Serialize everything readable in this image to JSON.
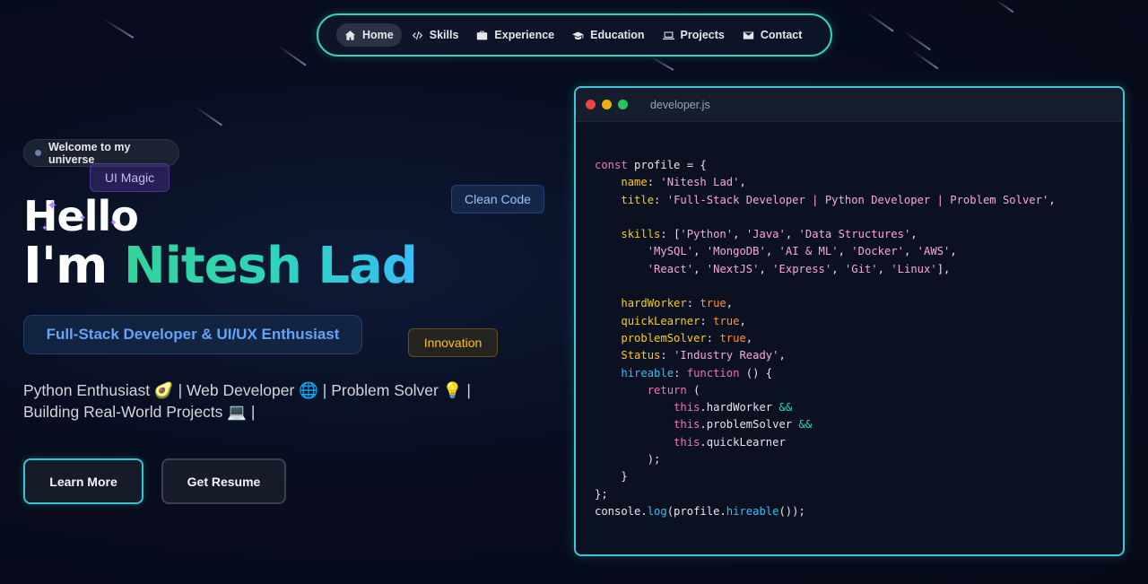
{
  "nav": {
    "items": [
      {
        "label": "Home",
        "icon": "home-icon",
        "active": true
      },
      {
        "label": "Skills",
        "icon": "code-icon",
        "active": false
      },
      {
        "label": "Experience",
        "icon": "briefcase-icon",
        "active": false
      },
      {
        "label": "Education",
        "icon": "graduation-cap-icon",
        "active": false
      },
      {
        "label": "Projects",
        "icon": "laptop-icon",
        "active": false
      },
      {
        "label": "Contact",
        "icon": "envelope-icon",
        "active": false
      }
    ]
  },
  "hero": {
    "welcome": "Welcome to my universe",
    "hello": "Hello",
    "iam_prefix": "I'm ",
    "name": "Nitesh Lad",
    "role": "Full-Stack Developer & UI/UX Enthusiast",
    "tagline": "Python Enthusiast 🥑 | Web Developer 🌐 | Problem Solver 💡 | Building Real-World Projects 💻 |",
    "learn_more": "Learn More",
    "get_resume": "Get Resume"
  },
  "floating_tags": {
    "ui_magic": "UI Magic",
    "clean_code": "Clean Code",
    "innovation": "Innovation"
  },
  "code_window": {
    "filename": "developer.js",
    "profile_name": "Nitesh Lad",
    "profile_title": "Full-Stack Developer | Python Developer | Problem Solver",
    "skills": [
      "Python",
      "Java",
      "Data Structures",
      "MySQL",
      "MongoDB",
      "AI & ML",
      "Docker",
      "AWS",
      "React",
      "NextJS",
      "Express",
      "Git",
      "Linux"
    ],
    "status": "Industry Ready"
  },
  "colors": {
    "accent_teal": "#2dd4bf",
    "accent_blue": "#60a5fa",
    "background": "#080d1f"
  }
}
